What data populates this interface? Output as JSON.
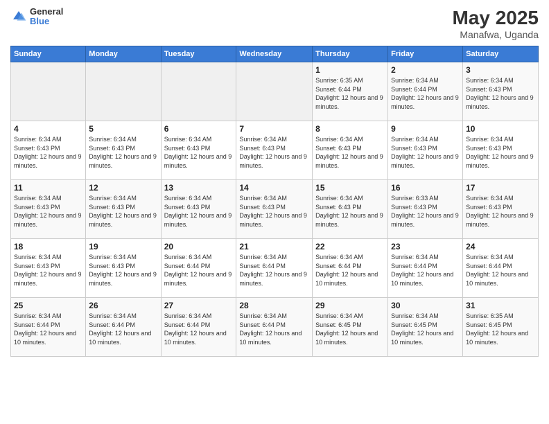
{
  "logo": {
    "general": "General",
    "blue": "Blue"
  },
  "header": {
    "title": "May 2025",
    "subtitle": "Manafwa, Uganda"
  },
  "days": [
    "Sunday",
    "Monday",
    "Tuesday",
    "Wednesday",
    "Thursday",
    "Friday",
    "Saturday"
  ],
  "weeks": [
    [
      {
        "day": "",
        "info": ""
      },
      {
        "day": "",
        "info": ""
      },
      {
        "day": "",
        "info": ""
      },
      {
        "day": "",
        "info": ""
      },
      {
        "day": "1",
        "info": "Sunrise: 6:35 AM\nSunset: 6:44 PM\nDaylight: 12 hours and 9 minutes."
      },
      {
        "day": "2",
        "info": "Sunrise: 6:34 AM\nSunset: 6:44 PM\nDaylight: 12 hours and 9 minutes."
      },
      {
        "day": "3",
        "info": "Sunrise: 6:34 AM\nSunset: 6:43 PM\nDaylight: 12 hours and 9 minutes."
      }
    ],
    [
      {
        "day": "4",
        "info": "Sunrise: 6:34 AM\nSunset: 6:43 PM\nDaylight: 12 hours and 9 minutes."
      },
      {
        "day": "5",
        "info": "Sunrise: 6:34 AM\nSunset: 6:43 PM\nDaylight: 12 hours and 9 minutes."
      },
      {
        "day": "6",
        "info": "Sunrise: 6:34 AM\nSunset: 6:43 PM\nDaylight: 12 hours and 9 minutes."
      },
      {
        "day": "7",
        "info": "Sunrise: 6:34 AM\nSunset: 6:43 PM\nDaylight: 12 hours and 9 minutes."
      },
      {
        "day": "8",
        "info": "Sunrise: 6:34 AM\nSunset: 6:43 PM\nDaylight: 12 hours and 9 minutes."
      },
      {
        "day": "9",
        "info": "Sunrise: 6:34 AM\nSunset: 6:43 PM\nDaylight: 12 hours and 9 minutes."
      },
      {
        "day": "10",
        "info": "Sunrise: 6:34 AM\nSunset: 6:43 PM\nDaylight: 12 hours and 9 minutes."
      }
    ],
    [
      {
        "day": "11",
        "info": "Sunrise: 6:34 AM\nSunset: 6:43 PM\nDaylight: 12 hours and 9 minutes."
      },
      {
        "day": "12",
        "info": "Sunrise: 6:34 AM\nSunset: 6:43 PM\nDaylight: 12 hours and 9 minutes."
      },
      {
        "day": "13",
        "info": "Sunrise: 6:34 AM\nSunset: 6:43 PM\nDaylight: 12 hours and 9 minutes."
      },
      {
        "day": "14",
        "info": "Sunrise: 6:34 AM\nSunset: 6:43 PM\nDaylight: 12 hours and 9 minutes."
      },
      {
        "day": "15",
        "info": "Sunrise: 6:34 AM\nSunset: 6:43 PM\nDaylight: 12 hours and 9 minutes."
      },
      {
        "day": "16",
        "info": "Sunrise: 6:33 AM\nSunset: 6:43 PM\nDaylight: 12 hours and 9 minutes."
      },
      {
        "day": "17",
        "info": "Sunrise: 6:34 AM\nSunset: 6:43 PM\nDaylight: 12 hours and 9 minutes."
      }
    ],
    [
      {
        "day": "18",
        "info": "Sunrise: 6:34 AM\nSunset: 6:43 PM\nDaylight: 12 hours and 9 minutes."
      },
      {
        "day": "19",
        "info": "Sunrise: 6:34 AM\nSunset: 6:43 PM\nDaylight: 12 hours and 9 minutes."
      },
      {
        "day": "20",
        "info": "Sunrise: 6:34 AM\nSunset: 6:44 PM\nDaylight: 12 hours and 9 minutes."
      },
      {
        "day": "21",
        "info": "Sunrise: 6:34 AM\nSunset: 6:44 PM\nDaylight: 12 hours and 9 minutes."
      },
      {
        "day": "22",
        "info": "Sunrise: 6:34 AM\nSunset: 6:44 PM\nDaylight: 12 hours and 10 minutes."
      },
      {
        "day": "23",
        "info": "Sunrise: 6:34 AM\nSunset: 6:44 PM\nDaylight: 12 hours and 10 minutes."
      },
      {
        "day": "24",
        "info": "Sunrise: 6:34 AM\nSunset: 6:44 PM\nDaylight: 12 hours and 10 minutes."
      }
    ],
    [
      {
        "day": "25",
        "info": "Sunrise: 6:34 AM\nSunset: 6:44 PM\nDaylight: 12 hours and 10 minutes."
      },
      {
        "day": "26",
        "info": "Sunrise: 6:34 AM\nSunset: 6:44 PM\nDaylight: 12 hours and 10 minutes."
      },
      {
        "day": "27",
        "info": "Sunrise: 6:34 AM\nSunset: 6:44 PM\nDaylight: 12 hours and 10 minutes."
      },
      {
        "day": "28",
        "info": "Sunrise: 6:34 AM\nSunset: 6:44 PM\nDaylight: 12 hours and 10 minutes."
      },
      {
        "day": "29",
        "info": "Sunrise: 6:34 AM\nSunset: 6:45 PM\nDaylight: 12 hours and 10 minutes."
      },
      {
        "day": "30",
        "info": "Sunrise: 6:34 AM\nSunset: 6:45 PM\nDaylight: 12 hours and 10 minutes."
      },
      {
        "day": "31",
        "info": "Sunrise: 6:35 AM\nSunset: 6:45 PM\nDaylight: 12 hours and 10 minutes."
      }
    ]
  ]
}
